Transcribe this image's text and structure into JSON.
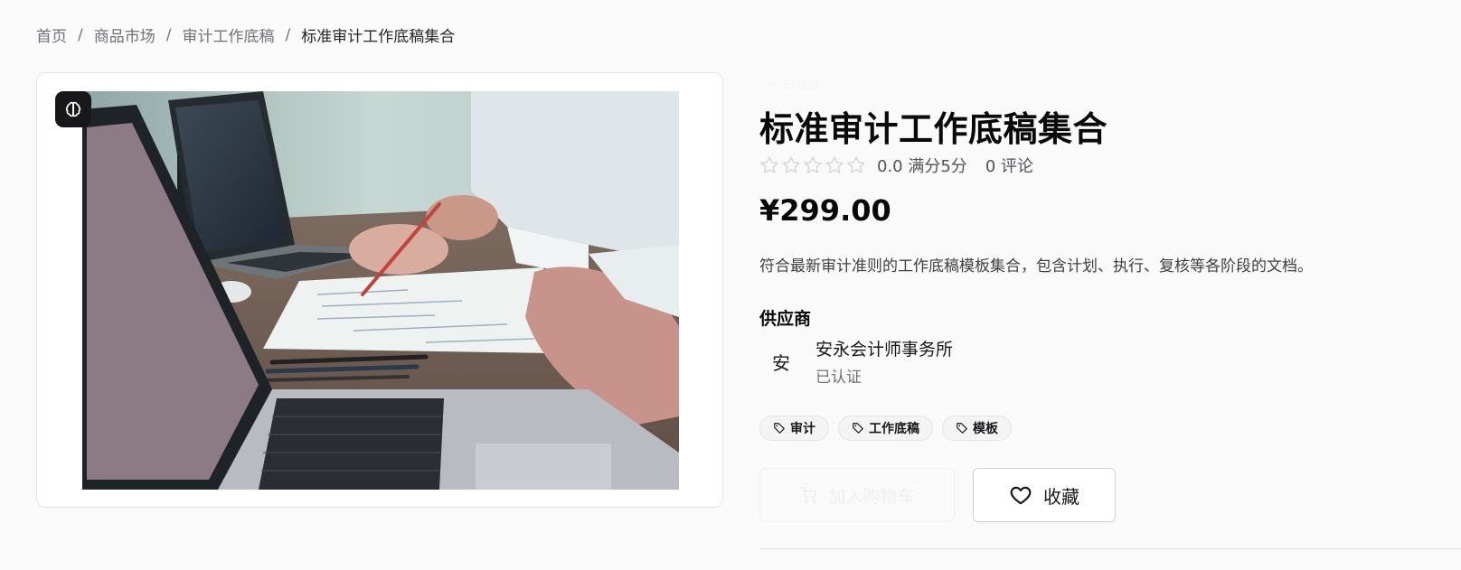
{
  "breadcrumb": {
    "items": [
      "首页",
      "商品市场",
      "审计工作底稿"
    ],
    "current": "标准审计工作底稿集合",
    "separator": "/"
  },
  "product": {
    "verified_badge": "✓ 已认证",
    "title": "标准审计工作底稿集合",
    "rating_value": "0.0 满分5分",
    "rating_stars": 0,
    "review_count": "0 评论",
    "price": "¥299.00",
    "description": "符合最新审计准则的工作底稿模板集合，包含计划、执行、复核等各阶段的文档。"
  },
  "supplier": {
    "heading": "供应商",
    "avatar_initial": "安",
    "name": "安永会计师事务所",
    "status": "已认证"
  },
  "tags": [
    "审计",
    "工作底稿",
    "模板"
  ],
  "actions": {
    "add_to_cart": "加入购物车",
    "favorite": "收藏"
  },
  "image": {
    "badge_icon": "brain-icon",
    "subject": "laptops-and-documents-photo"
  },
  "colors": {
    "badge_bg": "#18181b",
    "star_outline": "#d4d4d8",
    "tag_bg": "#f4f4f5"
  }
}
